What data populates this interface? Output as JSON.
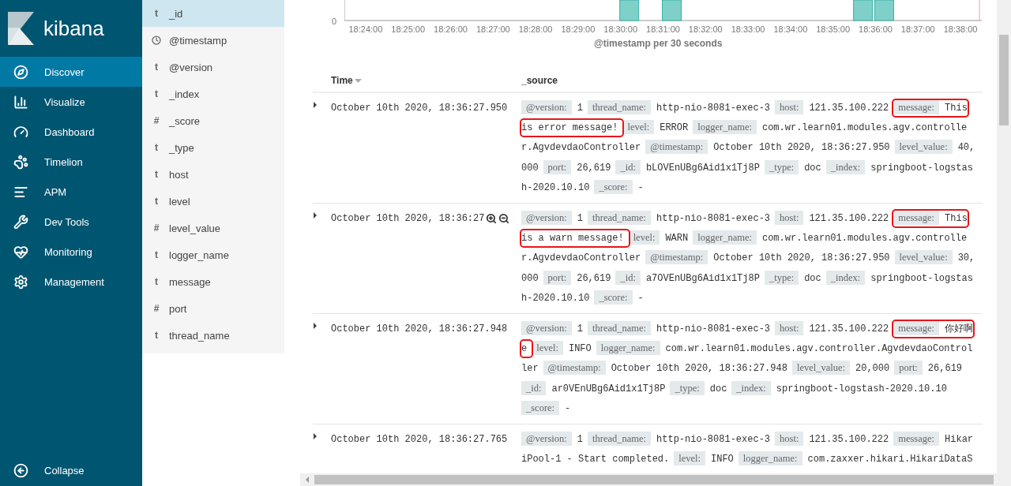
{
  "sidebar": {
    "logo": "kibana",
    "items": [
      {
        "label": "Discover",
        "selected": true
      },
      {
        "label": "Visualize",
        "selected": false
      },
      {
        "label": "Dashboard",
        "selected": false
      },
      {
        "label": "Timelion",
        "selected": false
      },
      {
        "label": "APM",
        "selected": false
      },
      {
        "label": "Dev Tools",
        "selected": false
      },
      {
        "label": "Monitoring",
        "selected": false
      },
      {
        "label": "Management",
        "selected": false
      }
    ],
    "collapse": "Collapse"
  },
  "fields": [
    {
      "name": "_id",
      "kind": "string",
      "glyph": "t",
      "selected": true
    },
    {
      "name": "@timestamp",
      "kind": "date",
      "selected": false
    },
    {
      "name": "@version",
      "kind": "string",
      "glyph": "t",
      "selected": false
    },
    {
      "name": "_index",
      "kind": "string",
      "glyph": "t",
      "selected": false
    },
    {
      "name": "_score",
      "kind": "number",
      "glyph": "#",
      "selected": false
    },
    {
      "name": "_type",
      "kind": "string",
      "glyph": "t",
      "selected": false
    },
    {
      "name": "host",
      "kind": "string",
      "glyph": "t",
      "selected": false
    },
    {
      "name": "level",
      "kind": "string",
      "glyph": "t",
      "selected": false
    },
    {
      "name": "level_value",
      "kind": "number",
      "glyph": "#",
      "selected": false
    },
    {
      "name": "logger_name",
      "kind": "string",
      "glyph": "t",
      "selected": false
    },
    {
      "name": "message",
      "kind": "string",
      "glyph": "t",
      "selected": false
    },
    {
      "name": "port",
      "kind": "number",
      "glyph": "#",
      "selected": false
    },
    {
      "name": "thread_name",
      "kind": "string",
      "glyph": "t",
      "selected": false
    }
  ],
  "histogram": {
    "y_label": "0",
    "x_labels": [
      "18:24:00",
      "18:25:00",
      "18:26:00",
      "18:27:00",
      "18:28:00",
      "18:29:00",
      "18:30:00",
      "18:31:00",
      "18:32:00",
      "18:33:00",
      "18:34:00",
      "18:35:00",
      "18:36:00",
      "18:37:00",
      "18:38:00"
    ],
    "axis_title": "@timestamp per 30 seconds"
  },
  "table": {
    "columns": [
      {
        "label": "Time",
        "sorted": true
      },
      {
        "label": "_source",
        "sorted": false
      }
    ],
    "rows": [
      {
        "time": "October 10th 2020, 18:36:27.950",
        "expanded": false,
        "hovered": false,
        "source": [
          {
            "key": "@version:",
            "value": "1",
            "highlighted": false
          },
          {
            "key": "thread_name:",
            "value": "http-nio-8081-exec-3",
            "highlighted": false
          },
          {
            "key": "host:",
            "value": "121.35.100.222",
            "highlighted": false
          },
          {
            "key": "message:",
            "value": "This is error message!",
            "highlighted": true
          },
          {
            "key": "level:",
            "value": "ERROR",
            "highlighted": false
          },
          {
            "key": "logger_name:",
            "value": "com.wr.learn01.modules.agv.controller.AgvdevdaoController",
            "highlighted": false
          },
          {
            "key": "@timestamp:",
            "value": "October 10th 2020, 18:36:27.950",
            "highlighted": false
          },
          {
            "key": "level_value:",
            "value": "40,000",
            "highlighted": false
          },
          {
            "key": "port:",
            "value": "26,619",
            "highlighted": false
          },
          {
            "key": "_id:",
            "value": "bLOVEnUBg6Aid1x1Tj8P",
            "highlighted": false
          },
          {
            "key": "_type:",
            "value": "doc",
            "highlighted": false
          },
          {
            "key": "_index:",
            "value": "springboot-logstash-2020.10.10",
            "highlighted": false
          },
          {
            "key": "_score:",
            "value": "-",
            "highlighted": false
          }
        ]
      },
      {
        "time": "October 10th 2020, 18:36:27",
        "expanded": false,
        "hovered": true,
        "source": [
          {
            "key": "@version:",
            "value": "1",
            "highlighted": false
          },
          {
            "key": "thread_name:",
            "value": "http-nio-8081-exec-3",
            "highlighted": false
          },
          {
            "key": "host:",
            "value": "121.35.100.222",
            "highlighted": false
          },
          {
            "key": "message:",
            "value": "This is a warn message!",
            "highlighted": true
          },
          {
            "key": "level:",
            "value": "WARN",
            "highlighted": false
          },
          {
            "key": "logger_name:",
            "value": "com.wr.learn01.modules.agv.controller.AgvdevdaoController",
            "highlighted": false
          },
          {
            "key": "@timestamp:",
            "value": "October 10th 2020, 18:36:27.950",
            "highlighted": false
          },
          {
            "key": "level_value:",
            "value": "30,000",
            "highlighted": false
          },
          {
            "key": "port:",
            "value": "26,619",
            "highlighted": false
          },
          {
            "key": "_id:",
            "value": "a7OVEnUBg6Aid1x1Tj8P",
            "highlighted": false
          },
          {
            "key": "_type:",
            "value": "doc",
            "highlighted": false
          },
          {
            "key": "_index:",
            "value": "springboot-logstash-2020.10.10",
            "highlighted": false
          },
          {
            "key": "_score:",
            "value": "-",
            "highlighted": false
          }
        ]
      },
      {
        "time": "October 10th 2020, 18:36:27.948",
        "expanded": false,
        "hovered": false,
        "source": [
          {
            "key": "@version:",
            "value": "1",
            "highlighted": false
          },
          {
            "key": "thread_name:",
            "value": "http-nio-8081-exec-3",
            "highlighted": false
          },
          {
            "key": "host:",
            "value": "121.35.100.222",
            "highlighted": false
          },
          {
            "key": "message:",
            "value": "你好啊e",
            "highlighted": true
          },
          {
            "key": "level:",
            "value": "INFO",
            "highlighted": false
          },
          {
            "key": "logger_name:",
            "value": "com.wr.learn01.modules.agv.controller.AgvdevdaoController",
            "highlighted": false
          },
          {
            "key": "@timestamp:",
            "value": "October 10th 2020, 18:36:27.948",
            "highlighted": false
          },
          {
            "key": "level_value:",
            "value": "20,000",
            "highlighted": false
          },
          {
            "key": "port:",
            "value": "26,619",
            "highlighted": false
          },
          {
            "key": "_id:",
            "value": "ar0VEnUBg6Aid1x1Tj8P",
            "highlighted": false
          },
          {
            "key": "_type:",
            "value": "doc",
            "highlighted": false
          },
          {
            "key": "_index:",
            "value": "springboot-logstash-2020.10.10",
            "highlighted": false
          },
          {
            "key": "_score:",
            "value": "-",
            "highlighted": false
          }
        ]
      },
      {
        "time": "October 10th 2020, 18:36:27.765",
        "expanded": false,
        "hovered": false,
        "source": [
          {
            "key": "@version:",
            "value": "1",
            "highlighted": false
          },
          {
            "key": "thread_name:",
            "value": "http-nio-8081-exec-3",
            "highlighted": false
          },
          {
            "key": "host:",
            "value": "121.35.100.222",
            "highlighted": false
          },
          {
            "key": "message:",
            "value": "HikariPool-1 - Start completed.",
            "highlighted": false
          },
          {
            "key": "level:",
            "value": "INFO",
            "highlighted": false
          },
          {
            "key": "logger_name:",
            "value": "com.zaxxer.hikari.HikariDataS",
            "highlighted": false
          }
        ]
      }
    ]
  }
}
